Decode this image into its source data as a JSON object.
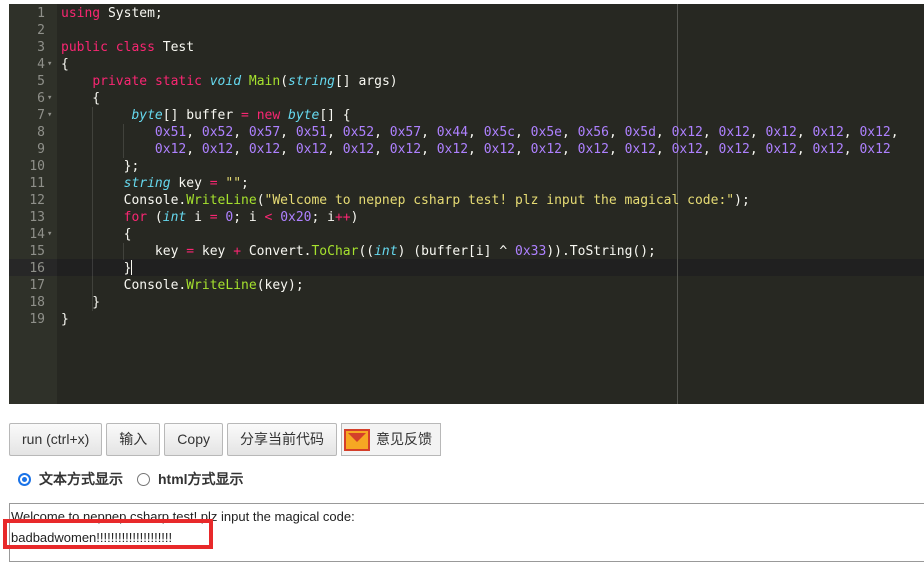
{
  "editor": {
    "lines": [
      {
        "n": "1",
        "fold": "",
        "tokens": [
          [
            "kw",
            "using"
          ],
          [
            "p",
            " System;"
          ]
        ]
      },
      {
        "n": "2",
        "fold": "",
        "tokens": []
      },
      {
        "n": "3",
        "fold": "",
        "tokens": [
          [
            "kw",
            "public"
          ],
          [
            "p",
            " "
          ],
          [
            "kw",
            "class"
          ],
          [
            "p",
            " Test"
          ]
        ]
      },
      {
        "n": "4",
        "fold": "▾",
        "tokens": [
          [
            "p",
            "{"
          ]
        ]
      },
      {
        "n": "5",
        "fold": "",
        "tokens": [
          [
            "p",
            "    "
          ],
          [
            "kw",
            "private"
          ],
          [
            "p",
            " "
          ],
          [
            "kw",
            "static"
          ],
          [
            "p",
            " "
          ],
          [
            "ty",
            "void"
          ],
          [
            "p",
            " "
          ],
          [
            "fn",
            "Main"
          ],
          [
            "p",
            "("
          ],
          [
            "ty",
            "string"
          ],
          [
            "p",
            "[] args)"
          ]
        ]
      },
      {
        "n": "6",
        "fold": "▾",
        "tokens": [
          [
            "p",
            "    {"
          ]
        ]
      },
      {
        "n": "7",
        "fold": "▾",
        "tokens": [
          [
            "p",
            "         "
          ],
          [
            "ty",
            "byte"
          ],
          [
            "p",
            "[] buffer "
          ],
          [
            "op",
            "="
          ],
          [
            "p",
            " "
          ],
          [
            "kw",
            "new"
          ],
          [
            "p",
            " "
          ],
          [
            "ty",
            "byte"
          ],
          [
            "p",
            "[] {"
          ]
        ]
      },
      {
        "n": "8",
        "fold": "",
        "tokens": [
          [
            "p",
            "            "
          ],
          [
            "nm",
            "0x51"
          ],
          [
            "p",
            ", "
          ],
          [
            "nm",
            "0x52"
          ],
          [
            "p",
            ", "
          ],
          [
            "nm",
            "0x57"
          ],
          [
            "p",
            ", "
          ],
          [
            "nm",
            "0x51"
          ],
          [
            "p",
            ", "
          ],
          [
            "nm",
            "0x52"
          ],
          [
            "p",
            ", "
          ],
          [
            "nm",
            "0x57"
          ],
          [
            "p",
            ", "
          ],
          [
            "nm",
            "0x44"
          ],
          [
            "p",
            ", "
          ],
          [
            "nm",
            "0x5c"
          ],
          [
            "p",
            ", "
          ],
          [
            "nm",
            "0x5e"
          ],
          [
            "p",
            ", "
          ],
          [
            "nm",
            "0x56"
          ],
          [
            "p",
            ", "
          ],
          [
            "nm",
            "0x5d"
          ],
          [
            "p",
            ", "
          ],
          [
            "nm",
            "0x12"
          ],
          [
            "p",
            ", "
          ],
          [
            "nm",
            "0x12"
          ],
          [
            "p",
            ", "
          ],
          [
            "nm",
            "0x12"
          ],
          [
            "p",
            ", "
          ],
          [
            "nm",
            "0x12"
          ],
          [
            "p",
            ", "
          ],
          [
            "nm",
            "0x12"
          ],
          [
            "p",
            ","
          ]
        ]
      },
      {
        "n": "9",
        "fold": "",
        "tokens": [
          [
            "p",
            "            "
          ],
          [
            "nm",
            "0x12"
          ],
          [
            "p",
            ", "
          ],
          [
            "nm",
            "0x12"
          ],
          [
            "p",
            ", "
          ],
          [
            "nm",
            "0x12"
          ],
          [
            "p",
            ", "
          ],
          [
            "nm",
            "0x12"
          ],
          [
            "p",
            ", "
          ],
          [
            "nm",
            "0x12"
          ],
          [
            "p",
            ", "
          ],
          [
            "nm",
            "0x12"
          ],
          [
            "p",
            ", "
          ],
          [
            "nm",
            "0x12"
          ],
          [
            "p",
            ", "
          ],
          [
            "nm",
            "0x12"
          ],
          [
            "p",
            ", "
          ],
          [
            "nm",
            "0x12"
          ],
          [
            "p",
            ", "
          ],
          [
            "nm",
            "0x12"
          ],
          [
            "p",
            ", "
          ],
          [
            "nm",
            "0x12"
          ],
          [
            "p",
            ", "
          ],
          [
            "nm",
            "0x12"
          ],
          [
            "p",
            ", "
          ],
          [
            "nm",
            "0x12"
          ],
          [
            "p",
            ", "
          ],
          [
            "nm",
            "0x12"
          ],
          [
            "p",
            ", "
          ],
          [
            "nm",
            "0x12"
          ],
          [
            "p",
            ", "
          ],
          [
            "nm",
            "0x12"
          ]
        ]
      },
      {
        "n": "10",
        "fold": "",
        "tokens": [
          [
            "p",
            "        };"
          ]
        ]
      },
      {
        "n": "11",
        "fold": "",
        "tokens": [
          [
            "p",
            "        "
          ],
          [
            "ty",
            "string"
          ],
          [
            "p",
            " key "
          ],
          [
            "op",
            "="
          ],
          [
            "p",
            " "
          ],
          [
            "st",
            "\"\""
          ],
          [
            "p",
            ";"
          ]
        ]
      },
      {
        "n": "12",
        "fold": "",
        "tokens": [
          [
            "p",
            "        Console."
          ],
          [
            "fn",
            "WriteLine"
          ],
          [
            "p",
            "("
          ],
          [
            "st",
            "\"Welcome to nepnep csharp test! plz input the magical code:\""
          ],
          [
            "p",
            ");"
          ]
        ]
      },
      {
        "n": "13",
        "fold": "",
        "tokens": [
          [
            "p",
            "        "
          ],
          [
            "kw",
            "for"
          ],
          [
            "p",
            " ("
          ],
          [
            "ty",
            "int"
          ],
          [
            "p",
            " i "
          ],
          [
            "op",
            "="
          ],
          [
            "p",
            " "
          ],
          [
            "nm",
            "0"
          ],
          [
            "p",
            "; i "
          ],
          [
            "op",
            "<"
          ],
          [
            "p",
            " "
          ],
          [
            "nm",
            "0x20"
          ],
          [
            "p",
            "; i"
          ],
          [
            "op",
            "++"
          ],
          [
            "p",
            ")"
          ]
        ]
      },
      {
        "n": "14",
        "fold": "▾",
        "tokens": [
          [
            "p",
            "        {"
          ]
        ]
      },
      {
        "n": "15",
        "fold": "",
        "tokens": [
          [
            "p",
            "            key "
          ],
          [
            "op",
            "="
          ],
          [
            "p",
            " key "
          ],
          [
            "op",
            "+"
          ],
          [
            "p",
            " Convert."
          ],
          [
            "fn",
            "ToChar"
          ],
          [
            "p",
            "(("
          ],
          [
            "ty",
            "int"
          ],
          [
            "p",
            ") (buffer[i] ^ "
          ],
          [
            "nm",
            "0x33"
          ],
          [
            "p",
            ")).ToString();"
          ]
        ]
      },
      {
        "n": "16",
        "fold": "",
        "tokens": [
          [
            "p",
            "        }"
          ],
          [
            "cursor",
            ""
          ]
        ]
      },
      {
        "n": "17",
        "fold": "",
        "tokens": [
          [
            "p",
            "        Console."
          ],
          [
            "fn",
            "WriteLine"
          ],
          [
            "p",
            "(key);"
          ]
        ]
      },
      {
        "n": "18",
        "fold": "",
        "tokens": [
          [
            "p",
            "    }"
          ]
        ]
      },
      {
        "n": "19",
        "fold": "",
        "tokens": [
          [
            "p",
            "}"
          ]
        ]
      }
    ]
  },
  "toolbar": {
    "run_label": "run (ctrl+x)",
    "input_label": "输入",
    "copy_label": "Copy",
    "share_label": "分享当前代码",
    "feedback_label": "意见反馈"
  },
  "display": {
    "text_mode_label": "文本方式显示",
    "html_mode_label": "html方式显示",
    "selected": "text"
  },
  "output": {
    "line1": "Welcome to nepnep csharp test! plz input the magical code:",
    "line2": "badbadwomen!!!!!!!!!!!!!!!!!!!!!"
  },
  "colors": {
    "editor_bg": "#272822",
    "keyword": "#f92672",
    "type": "#66d9ef",
    "string": "#e6db74",
    "number": "#ae81ff",
    "highlight_box": "#e8292a"
  }
}
